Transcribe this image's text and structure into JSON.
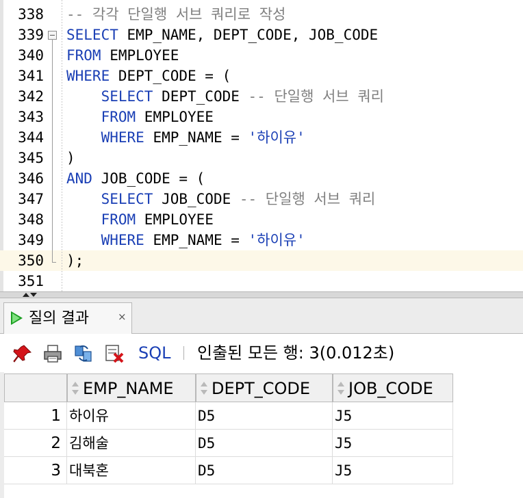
{
  "editor": {
    "lines": [
      {
        "num": "338",
        "tokens": [
          {
            "t": "-- 각각 단일행 서브 쿼리로 작성",
            "c": "cm"
          }
        ]
      },
      {
        "num": "339",
        "tokens": [
          {
            "t": "SELECT",
            "c": "kw"
          },
          {
            "t": " EMP_NAME, DEPT_CODE, JOB_CODE",
            "c": ""
          }
        ]
      },
      {
        "num": "340",
        "tokens": [
          {
            "t": "FROM",
            "c": "kw"
          },
          {
            "t": " EMPLOYEE",
            "c": ""
          }
        ]
      },
      {
        "num": "341",
        "tokens": [
          {
            "t": "WHERE",
            "c": "kw"
          },
          {
            "t": " DEPT_CODE = (",
            "c": ""
          }
        ]
      },
      {
        "num": "342",
        "tokens": [
          {
            "t": "    ",
            "c": ""
          },
          {
            "t": "SELECT",
            "c": "kw"
          },
          {
            "t": " DEPT_CODE ",
            "c": ""
          },
          {
            "t": "-- 단일행 서브 쿼리",
            "c": "cm"
          }
        ]
      },
      {
        "num": "343",
        "tokens": [
          {
            "t": "    ",
            "c": ""
          },
          {
            "t": "FROM",
            "c": "kw"
          },
          {
            "t": " EMPLOYEE",
            "c": ""
          }
        ]
      },
      {
        "num": "344",
        "tokens": [
          {
            "t": "    ",
            "c": ""
          },
          {
            "t": "WHERE",
            "c": "kw"
          },
          {
            "t": " EMP_NAME = ",
            "c": ""
          },
          {
            "t": "'하이유'",
            "c": "str"
          }
        ]
      },
      {
        "num": "345",
        "tokens": [
          {
            "t": ")",
            "c": ""
          }
        ]
      },
      {
        "num": "346",
        "tokens": [
          {
            "t": "AND",
            "c": "kw"
          },
          {
            "t": " JOB_CODE = (",
            "c": ""
          }
        ]
      },
      {
        "num": "347",
        "tokens": [
          {
            "t": "    ",
            "c": ""
          },
          {
            "t": "SELECT",
            "c": "kw"
          },
          {
            "t": " JOB_CODE ",
            "c": ""
          },
          {
            "t": "-- 단일행 서브 쿼리",
            "c": "cm"
          }
        ]
      },
      {
        "num": "348",
        "tokens": [
          {
            "t": "    ",
            "c": ""
          },
          {
            "t": "FROM",
            "c": "kw"
          },
          {
            "t": " EMPLOYEE",
            "c": ""
          }
        ]
      },
      {
        "num": "349",
        "tokens": [
          {
            "t": "    ",
            "c": ""
          },
          {
            "t": "WHERE",
            "c": "kw"
          },
          {
            "t": " EMP_NAME = ",
            "c": ""
          },
          {
            "t": "'하이유'",
            "c": "str"
          }
        ]
      },
      {
        "num": "350",
        "tokens": [
          {
            "t": ");",
            "c": ""
          }
        ],
        "current": true
      },
      {
        "num": "351",
        "tokens": []
      }
    ]
  },
  "results": {
    "tab_label": "질의 결과",
    "tab_close": "×",
    "toolbar": {
      "sql_label": "SQL",
      "fetch_message": "인출된 모든 행: 3(0.012초)"
    },
    "columns": [
      "EMP_NAME",
      "DEPT_CODE",
      "JOB_CODE"
    ],
    "rows": [
      {
        "num": "1",
        "cells": [
          "하이유",
          "D5",
          "J5"
        ]
      },
      {
        "num": "2",
        "cells": [
          "김해술",
          "D5",
          "J5"
        ]
      },
      {
        "num": "3",
        "cells": [
          "대북혼",
          "D5",
          "J5"
        ]
      }
    ]
  },
  "colors": {
    "keyword": "#1a3fb5",
    "comment": "#7f7f7f",
    "current_line": "#fdf8e8",
    "run_icon": "#1b9e22"
  },
  "icons": [
    "pin-icon",
    "print-icon",
    "refresh-icon",
    "export-icon",
    "run-query-icon",
    "sort-icon"
  ]
}
